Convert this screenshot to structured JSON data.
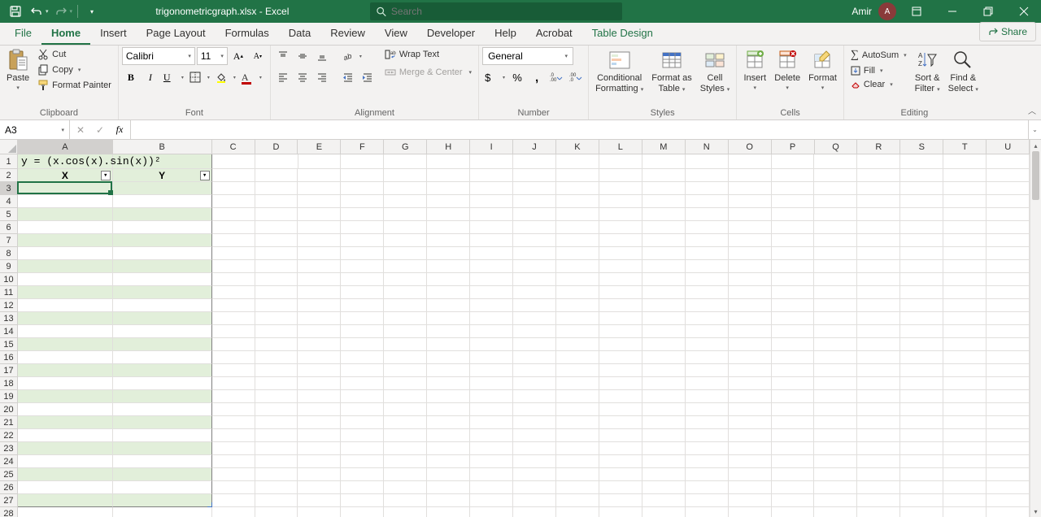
{
  "title": {
    "filename": "trigonometricgraph.xlsx",
    "app": "Excel",
    "sep": " - "
  },
  "search": {
    "placeholder": "Search"
  },
  "user": {
    "name": "Amir",
    "initials": "A"
  },
  "tabs": [
    "File",
    "Home",
    "Insert",
    "Page Layout",
    "Formulas",
    "Data",
    "Review",
    "View",
    "Developer",
    "Help",
    "Acrobat",
    "Table Design"
  ],
  "active_tab": "Home",
  "share": "Share",
  "ribbon": {
    "clipboard": {
      "paste": "Paste",
      "cut": "Cut",
      "copy": "Copy",
      "format_painter": "Format Painter",
      "label": "Clipboard"
    },
    "font": {
      "name": "Calibri",
      "size": "11",
      "label": "Font"
    },
    "alignment": {
      "wrap": "Wrap Text",
      "merge": "Merge & Center",
      "label": "Alignment"
    },
    "number": {
      "format": "General",
      "label": "Number"
    },
    "styles": {
      "cond": "Conditional Formatting",
      "table": "Format as Table",
      "cell": "Cell Styles",
      "label": "Styles"
    },
    "cells": {
      "insert": "Insert",
      "delete": "Delete",
      "format": "Format",
      "label": "Cells"
    },
    "editing": {
      "sum": "AutoSum",
      "fill": "Fill",
      "clear": "Clear",
      "sort": "Sort & Filter",
      "find": "Find & Select",
      "label": "Editing"
    }
  },
  "namebox": "A3",
  "formula": "",
  "columns": [
    "A",
    "B",
    "C",
    "D",
    "E",
    "F",
    "G",
    "H",
    "I",
    "J",
    "K",
    "L",
    "M",
    "N",
    "O",
    "P",
    "Q",
    "R",
    "S",
    "T",
    "U"
  ],
  "col_widths": {
    "A": 117,
    "B": 122,
    "default": 53
  },
  "row_count": 28,
  "table": {
    "title_text": "y = (x.cos(x).sin(x))²",
    "headers": [
      "X",
      "Y"
    ],
    "last_row": 27
  },
  "active_cell": {
    "col": "A",
    "row": 3
  }
}
